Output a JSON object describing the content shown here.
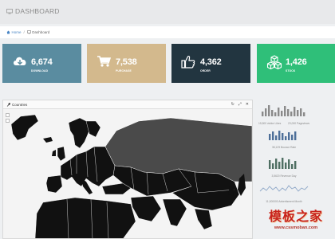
{
  "header": {
    "title": "DASHBOARD"
  },
  "breadcrumb": {
    "home": "Home",
    "current": "Dashboard"
  },
  "stats": [
    {
      "value": "6,674",
      "label": "DOWNLOAD",
      "color": "#5a8ca0",
      "icon": "cloud-download-icon"
    },
    {
      "value": "7,538",
      "label": "PURCHASE",
      "color": "#d3b98d",
      "icon": "shopping-cart-icon"
    },
    {
      "value": "4,362",
      "label": "ORDER",
      "color": "#223540",
      "icon": "thumbs-up-icon"
    },
    {
      "value": "1,426",
      "label": "STOCK",
      "color": "#2fbf79",
      "icon": "cubes-icon"
    }
  ],
  "map_panel": {
    "title": "Countries"
  },
  "sparklines": [
    {
      "caption": "15,500 visitor Likes",
      "color": "#8a8a8a",
      "type": "bar"
    },
    {
      "caption": "23,000 Pageviews",
      "color": "#8a8a8a",
      "type": "bar"
    },
    {
      "caption": "38,129 Bounce Rate",
      "color": "#4d6f99",
      "type": "bar"
    },
    {
      "caption": "3,5620 Revenue Day",
      "color": "#4f6f63",
      "type": "bar"
    },
    {
      "caption": "11,000000 Advertisment Month",
      "color": "#8fa8c8",
      "type": "line"
    }
  ],
  "watermark": {
    "cn": "模板之家",
    "url": "www.cssmoban.com"
  }
}
